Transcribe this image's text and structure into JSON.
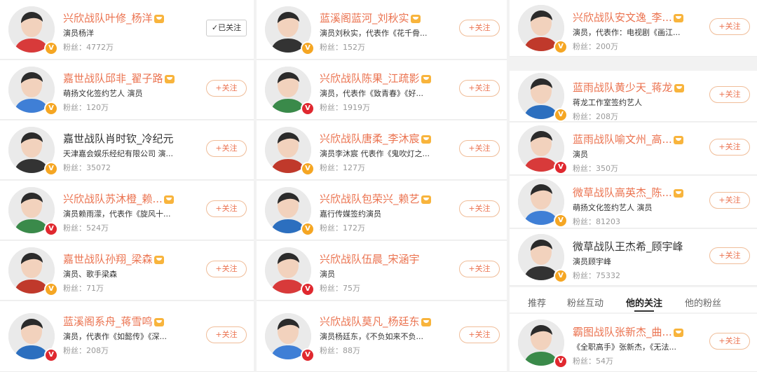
{
  "colors": {
    "accent": "#eb7350",
    "verified_gold": "#f5a623",
    "verified_red": "#e0282f"
  },
  "columns": [
    [
      {
        "name": "兴欣战队叶修_杨洋",
        "vip": true,
        "desc": "演员杨洋",
        "fans": "粉丝：4772万",
        "button": "✓已关注",
        "followed": true,
        "badge": "gold"
      },
      {
        "name": "嘉世战队邱非_翟子路",
        "vip": true,
        "desc": "萌扬文化签约艺人 演员",
        "fans": "粉丝：120万",
        "button": "+关注",
        "followed": false,
        "badge": "gold"
      },
      {
        "name": "嘉世战队肖时钦_冷纪元",
        "vip": false,
        "desc": "天津嘉会娱乐经纪有限公司 演...",
        "fans": "粉丝：35072",
        "button": "+关注",
        "followed": false,
        "badge": "gold"
      },
      {
        "name": "兴欣战队苏沐橙_赖...",
        "vip": true,
        "desc": "演员赖雨濛，代表作《旋风十...",
        "fans": "粉丝：524万",
        "button": "+关注",
        "followed": false,
        "badge": "red"
      },
      {
        "name": "嘉世战队孙翔_梁森",
        "vip": true,
        "desc": "演员、歌手梁森",
        "fans": "粉丝：71万",
        "button": "+关注",
        "followed": false,
        "badge": "gold"
      },
      {
        "name": "蓝溪阁系舟_蒋雪鸣",
        "vip": true,
        "desc": "演员，代表作《如懿传》《深...",
        "fans": "粉丝：208万",
        "button": "+关注",
        "followed": false,
        "badge": "red"
      }
    ],
    [
      {
        "name": "蓝溪阁蓝河_刘秋实",
        "vip": true,
        "desc": "演员刘秋实，代表作《花千骨...",
        "fans": "粉丝：152万",
        "button": "+关注",
        "followed": false,
        "badge": "gold"
      },
      {
        "name": "兴欣战队陈果_江疏影",
        "vip": true,
        "desc": "演员，代表作《致青春》《好...",
        "fans": "粉丝：1919万",
        "button": "+关注",
        "followed": false,
        "badge": "red"
      },
      {
        "name": "兴欣战队唐柔_李沐宸",
        "vip": true,
        "desc": "演员李沐宸 代表作《鬼吹灯之...",
        "fans": "粉丝：127万",
        "button": "+关注",
        "followed": false,
        "badge": "gold"
      },
      {
        "name": "兴欣战队包荣兴_赖艺",
        "vip": true,
        "desc": "嘉行传媒签约演员",
        "fans": "粉丝：172万",
        "button": "+关注",
        "followed": false,
        "badge": "gold"
      },
      {
        "name": "兴欣战队伍晨_宋涵宇",
        "vip": false,
        "desc": "演员",
        "fans": "粉丝：75万",
        "button": "+关注",
        "followed": false,
        "badge": "red"
      },
      {
        "name": "兴欣战队莫凡_杨廷东",
        "vip": true,
        "desc": "演员杨廷东，《不负如来不负...",
        "fans": "粉丝：88万",
        "button": "+关注",
        "followed": false,
        "badge": "red"
      }
    ],
    [
      {
        "name": "兴欣战队安文逸_李...",
        "vip": true,
        "desc": "演员，代表作：电视剧《画江...",
        "fans": "粉丝：200万",
        "button": "+关注",
        "followed": false,
        "badge": "gold"
      },
      {
        "name": "蓝雨战队黄少天_蒋龙",
        "vip": true,
        "desc": "蒋龙工作室签约艺人",
        "fans": "粉丝：208万",
        "button": "+关注",
        "followed": false,
        "badge": "gold"
      },
      {
        "name": "蓝雨战队喻文州_高...",
        "vip": true,
        "desc": "演员",
        "fans": "粉丝：350万",
        "button": "+关注",
        "followed": false,
        "badge": "red"
      },
      {
        "name": "微草战队高英杰_陈...",
        "vip": true,
        "desc": "萌扬文化签约艺人 演员",
        "fans": "粉丝：81203",
        "button": "+关注",
        "followed": false,
        "badge": "gold"
      },
      {
        "name": "微草战队王杰希_顾宇峰",
        "vip": false,
        "desc": "演员顾宇峰",
        "fans": "粉丝：75332",
        "button": "+关注",
        "followed": false,
        "badge": "gold"
      },
      {
        "name": "霸图战队张新杰_曲...",
        "vip": true,
        "desc": "《全职高手》张新杰，《无法...",
        "fans": "粉丝：54万",
        "button": "+关注",
        "followed": false,
        "badge": "red"
      }
    ]
  ],
  "tabs": [
    {
      "label": "推荐",
      "active": false
    },
    {
      "label": "粉丝互动",
      "active": false
    },
    {
      "label": "他的关注",
      "active": true
    },
    {
      "label": "他的粉丝",
      "active": false
    }
  ]
}
